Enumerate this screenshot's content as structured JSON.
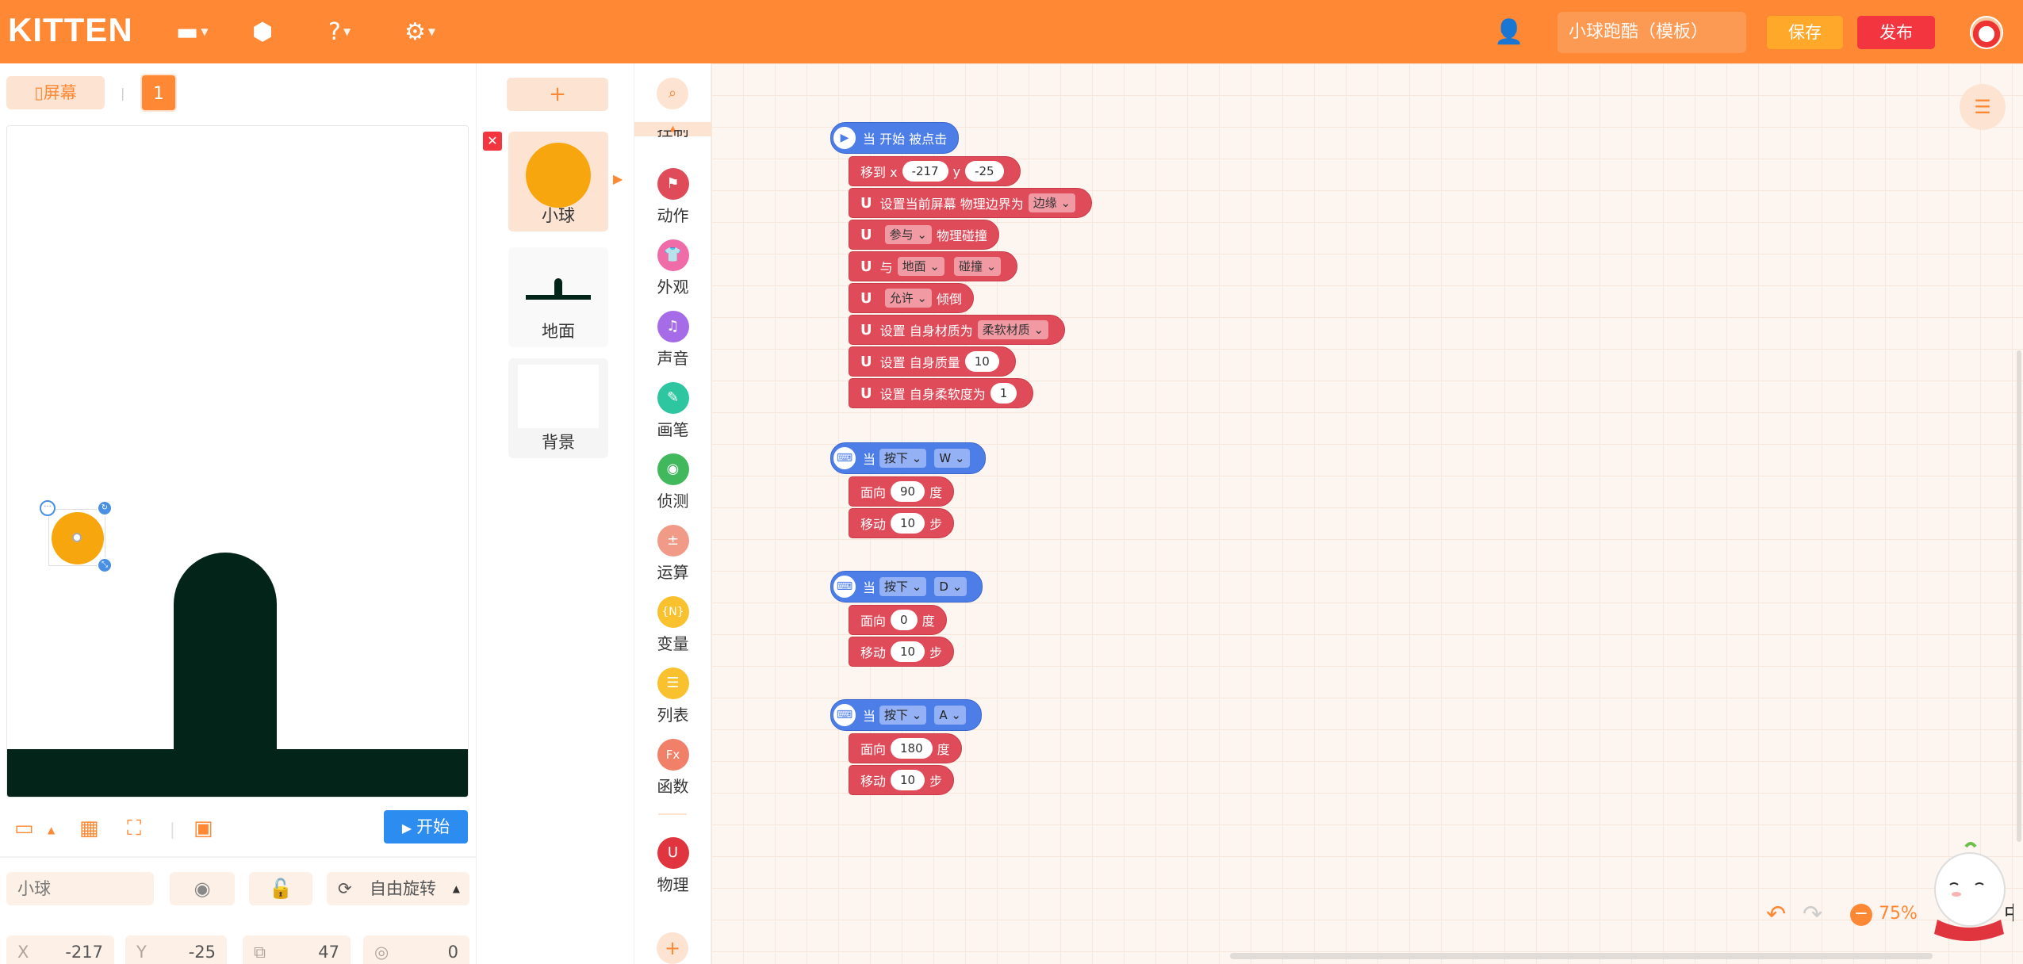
{
  "header": {
    "logo": "KITTEN",
    "project_name": "小球跑酷（模板）",
    "save_label": "保存",
    "publish_label": "发布"
  },
  "stage": {
    "screen_label": "屏幕",
    "screen_number": "1",
    "start_label": "开始",
    "sprite_name": "小球",
    "rotation_label": "自由旋转",
    "props": {
      "x_label": "X",
      "x_value": "-217",
      "y_label": "Y",
      "y_value": "-25",
      "size_value": "47",
      "direction_value": "0"
    }
  },
  "sprites": {
    "add_label": "+",
    "items": [
      "小球",
      "地面",
      "背景"
    ]
  },
  "categories": {
    "items": [
      {
        "label": "控制",
        "color": "#f7a70d"
      },
      {
        "label": "动作",
        "color": "#e04b5a"
      },
      {
        "label": "外观",
        "color": "#f06ca8"
      },
      {
        "label": "声音",
        "color": "#a66ce8"
      },
      {
        "label": "画笔",
        "color": "#2ec6a0"
      },
      {
        "label": "侦测",
        "color": "#41b85c"
      },
      {
        "label": "运算",
        "color": "#f19a88"
      },
      {
        "label": "变量",
        "color": "#f8c12d"
      },
      {
        "label": "列表",
        "color": "#f8c12d"
      },
      {
        "label": "函数",
        "color": "#f08068"
      },
      {
        "label": "物理",
        "color": "#e0343f"
      }
    ]
  },
  "workspace": {
    "zoom": "75%",
    "script1": {
      "hat": "当 开始 被点击",
      "move_label": "移到 x",
      "x": "-217",
      "y_label": "y",
      "y": "-25",
      "boundary_label": "设置当前屏幕 物理边界为",
      "boundary_value": "边缘",
      "join_value": "参与",
      "join_label": "物理碰撞",
      "with_label": "与",
      "with_target": "地面",
      "with_mode": "碰撞",
      "allow_value": "允许",
      "allow_label": "倾倒",
      "material_label": "设置 自身材质为",
      "material_value": "柔软材质",
      "mass_label": "设置 自身质量",
      "mass_value": "10",
      "softness_label": "设置 自身柔软度为",
      "softness_value": "1"
    },
    "key_scripts": [
      {
        "when": "当",
        "press": "按下",
        "key": "W",
        "face_label": "面向",
        "angle": "90",
        "deg": "度",
        "move_label": "移动",
        "steps": "10",
        "step_unit": "步"
      },
      {
        "when": "当",
        "press": "按下",
        "key": "D",
        "face_label": "面向",
        "angle": "0",
        "deg": "度",
        "move_label": "移动",
        "steps": "10",
        "step_unit": "步"
      },
      {
        "when": "当",
        "press": "按下",
        "key": "A",
        "face_label": "面向",
        "angle": "180",
        "deg": "度",
        "move_label": "移动",
        "steps": "10",
        "step_unit": "步"
      }
    ],
    "mascot_badge": "中"
  }
}
